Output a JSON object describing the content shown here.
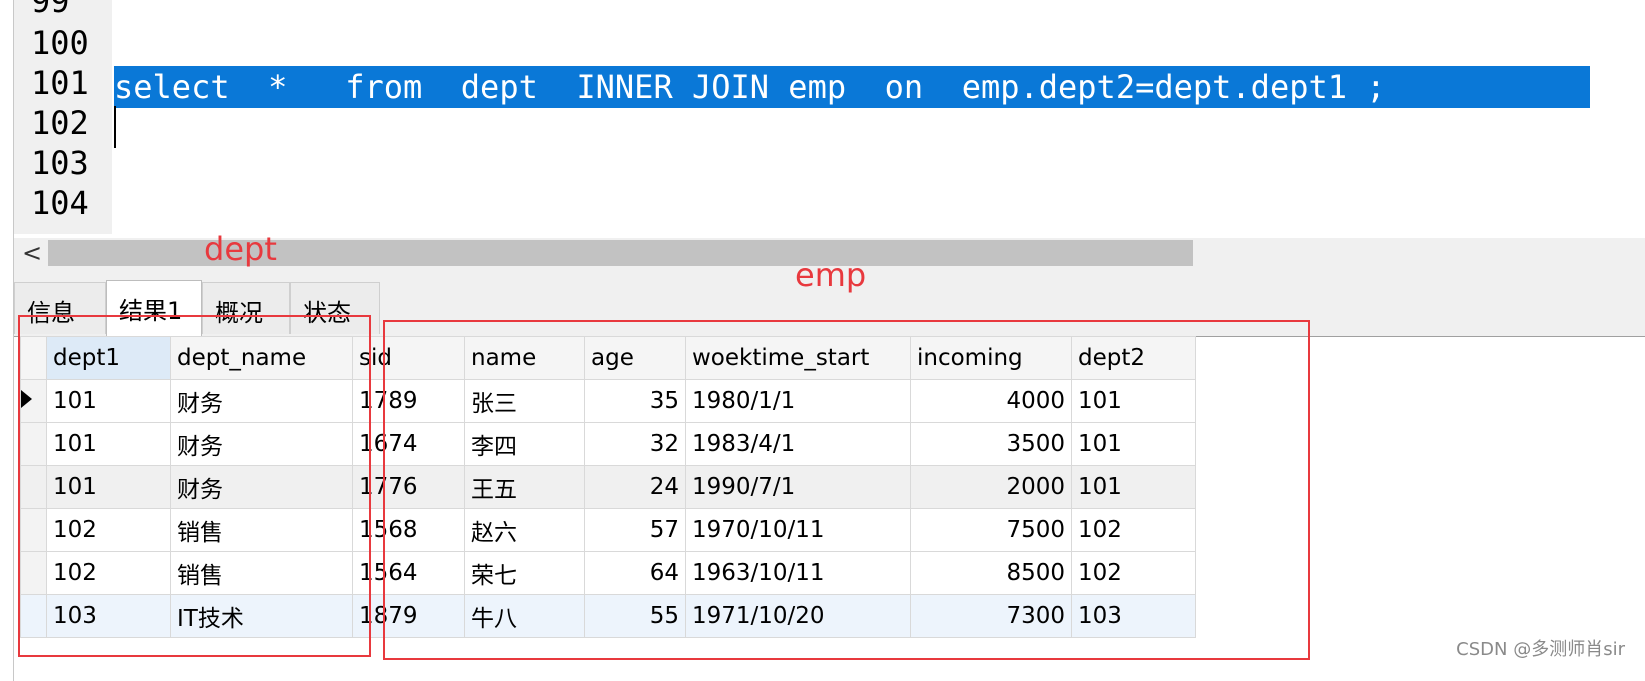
{
  "editor": {
    "line_numbers": [
      "99",
      "100",
      "101",
      "102",
      "103",
      "104"
    ],
    "selected_sql": "select  *   from  dept  INNER JOIN emp  on  emp.dept2=dept.dept1 ;"
  },
  "tabs": [
    {
      "label": "信息",
      "active": false
    },
    {
      "label": "结果1",
      "active": true
    },
    {
      "label": "概况",
      "active": false
    },
    {
      "label": "状态",
      "active": false
    }
  ],
  "grid": {
    "columns": [
      "dept1",
      "dept_name",
      "sid",
      "name",
      "age",
      "woektime_start",
      "incoming",
      "dept2"
    ],
    "rows": [
      [
        "101",
        "财务",
        "1789",
        "张三",
        "35",
        "1980/1/1",
        "4000",
        "101"
      ],
      [
        "101",
        "财务",
        "1674",
        "李四",
        "32",
        "1983/4/1",
        "3500",
        "101"
      ],
      [
        "101",
        "财务",
        "1776",
        "王五",
        "24",
        "1990/7/1",
        "2000",
        "101"
      ],
      [
        "102",
        "销售",
        "1568",
        "赵六",
        "57",
        "1970/10/11",
        "7500",
        "102"
      ],
      [
        "102",
        "销售",
        "1564",
        "荣七",
        "64",
        "1963/10/11",
        "8500",
        "102"
      ],
      [
        "103",
        "IT技术",
        "1879",
        "牛八",
        "55",
        "1971/10/20",
        "7300",
        "103"
      ]
    ]
  },
  "annotations": {
    "dept_label": "dept",
    "emp_label": "emp",
    "color": "#e8393e"
  },
  "watermark": "CSDN @多测师肖sir"
}
